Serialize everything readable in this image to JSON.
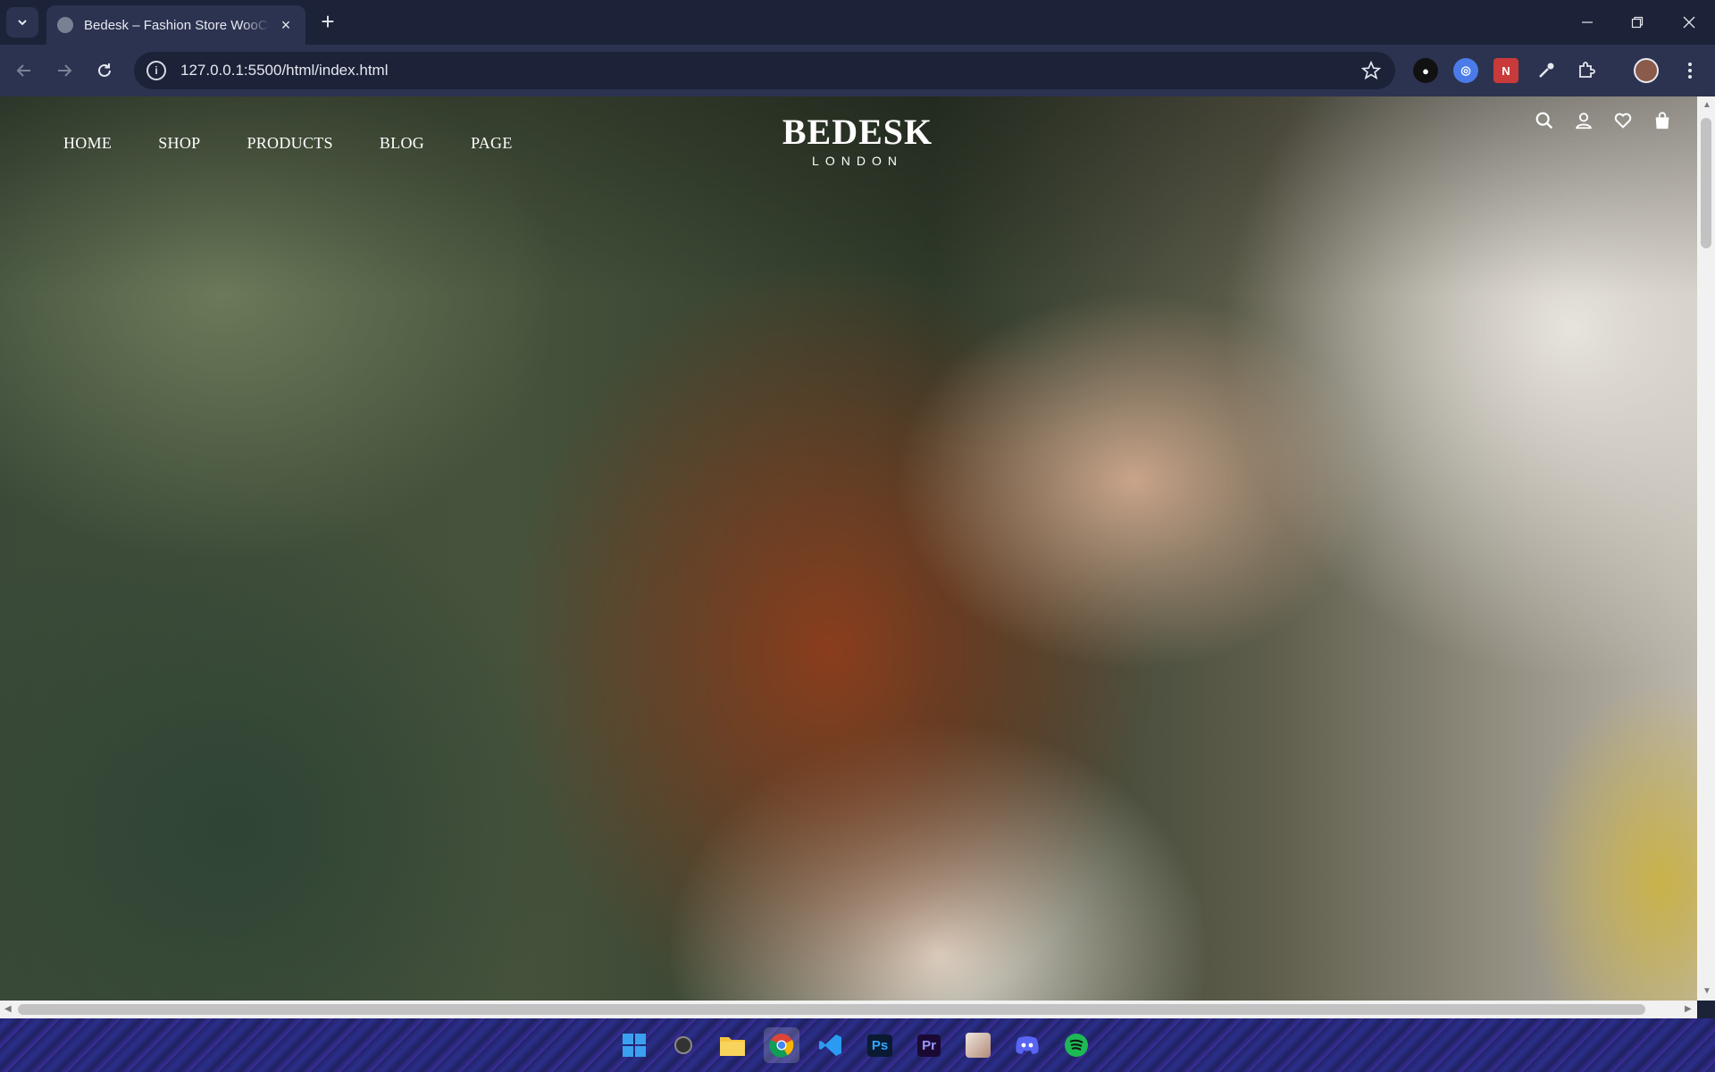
{
  "browser": {
    "tab_title": "Bedesk – Fashion Store WooCommerce",
    "url": "127.0.0.1:5500/html/index.html",
    "new_tab_label": "+",
    "tab_close_label": "×"
  },
  "site": {
    "nav": [
      "HOME",
      "SHOP",
      "PRODUCTS",
      "BLOG",
      "PAGE"
    ],
    "brand_name": "BEDESK",
    "brand_sub": "LONDON",
    "icons": [
      "search-icon",
      "user-icon",
      "heart-icon",
      "bag-icon"
    ]
  },
  "extensions": [
    "extension-1",
    "extension-2",
    "extension-3",
    "eyedropper-extension",
    "puzzle-icon",
    "profile-avatar"
  ],
  "taskbar": {
    "apps": [
      "windows-start",
      "search",
      "file-explorer",
      "chrome",
      "vscode",
      "photoshop",
      "premiere",
      "app-8",
      "discord",
      "spotify"
    ],
    "ps_label": "Ps",
    "pr_label": "Pr"
  },
  "colors": {
    "tabstrip": "#1c2238",
    "toolbar": "#2c3350"
  }
}
